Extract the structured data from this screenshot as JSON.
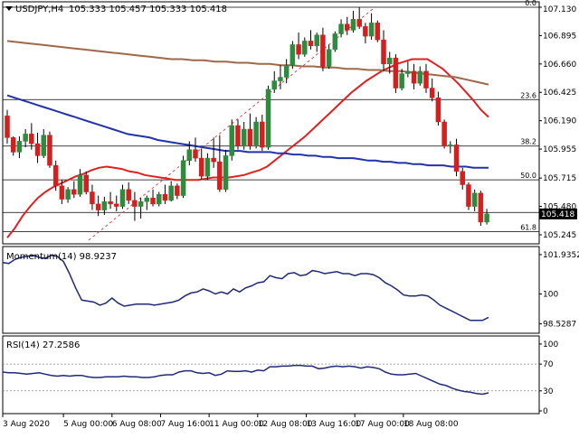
{
  "symbol_header": {
    "icon": "triangle-down-icon",
    "title": "USDJPY,H4",
    "ohlc": "105.333 105.457 105.333 105.418"
  },
  "colors": {
    "bull": "#2e8b3d",
    "bear": "#d21f1f",
    "ma_fast": "#e02020",
    "ma_mid": "#2233aa",
    "ma_slow": "#a0684a",
    "fib": "#000000",
    "trend": "#d21f1f",
    "indicator": "#1f2a7a",
    "price_tag_bg": "#000000",
    "price_tag_fg": "#ffffff"
  },
  "chart_data": [
    {
      "type": "candlestick",
      "name": "USDJPY,H4",
      "ylim": [
        105.2,
        107.13
      ],
      "y_ticks": [
        "107.130",
        "106.895",
        "106.660",
        "106.425",
        "106.190",
        "105.955",
        "105.715",
        "105.480",
        "105.245"
      ],
      "current_price": "105.418",
      "fib_levels": [
        {
          "label": "0.0",
          "value": 107.13
        },
        {
          "label": "23.6",
          "value": 106.365
        },
        {
          "label": "38.2",
          "value": 105.98
        },
        {
          "label": "50.0",
          "value": 105.7
        },
        {
          "label": "61.8",
          "value": 105.27
        }
      ],
      "extra_hline": 105.43,
      "trendline": {
        "from": [
          0,
          105.2
        ],
        "to": [
          71,
          107.13
        ]
      },
      "candles": [
        [
          106.23,
          106.28,
          106.0,
          106.05
        ],
        [
          106.05,
          106.06,
          105.9,
          105.93
        ],
        [
          105.93,
          106.06,
          105.88,
          106.02
        ],
        [
          106.02,
          106.12,
          105.97,
          106.08
        ],
        [
          106.08,
          106.17,
          105.95,
          106.0
        ],
        [
          106.0,
          106.09,
          105.84,
          105.9
        ],
        [
          105.9,
          106.12,
          105.88,
          106.07
        ],
        [
          106.07,
          106.1,
          105.8,
          105.82
        ],
        [
          105.82,
          105.86,
          105.61,
          105.65
        ],
        [
          105.65,
          105.7,
          105.5,
          105.54
        ],
        [
          105.54,
          105.64,
          105.51,
          105.62
        ],
        [
          105.62,
          105.69,
          105.55,
          105.58
        ],
        [
          105.58,
          105.79,
          105.56,
          105.74
        ],
        [
          105.74,
          105.77,
          105.58,
          105.6
        ],
        [
          105.6,
          105.66,
          105.45,
          105.5
        ],
        [
          105.5,
          105.57,
          105.4,
          105.45
        ],
        [
          105.45,
          105.56,
          105.41,
          105.52
        ],
        [
          105.52,
          105.6,
          105.46,
          105.5
        ],
        [
          105.5,
          105.57,
          105.44,
          105.48
        ],
        [
          105.48,
          105.66,
          105.46,
          105.62
        ],
        [
          105.62,
          105.68,
          105.5,
          105.53
        ],
        [
          105.53,
          105.6,
          105.36,
          105.48
        ],
        [
          105.48,
          105.55,
          105.38,
          105.52
        ],
        [
          105.52,
          105.57,
          105.45,
          105.55
        ],
        [
          105.55,
          105.62,
          105.48,
          105.5
        ],
        [
          105.5,
          105.6,
          105.48,
          105.58
        ],
        [
          105.58,
          105.66,
          105.5,
          105.53
        ],
        [
          105.53,
          105.69,
          105.52,
          105.65
        ],
        [
          105.65,
          105.67,
          105.54,
          105.57
        ],
        [
          105.57,
          105.9,
          105.55,
          105.86
        ],
        [
          105.86,
          106.02,
          105.82,
          105.95
        ],
        [
          105.95,
          106.05,
          105.85,
          105.88
        ],
        [
          105.88,
          105.96,
          105.7,
          105.73
        ],
        [
          105.73,
          105.92,
          105.7,
          105.88
        ],
        [
          105.88,
          106.05,
          105.8,
          105.85
        ],
        [
          105.85,
          106.07,
          105.6,
          105.62
        ],
        [
          105.62,
          105.95,
          105.6,
          105.9
        ],
        [
          105.9,
          106.2,
          105.86,
          106.15
        ],
        [
          106.15,
          106.2,
          105.95,
          105.98
        ],
        [
          105.98,
          106.18,
          105.95,
          106.12
        ],
        [
          106.12,
          106.25,
          105.95,
          105.98
        ],
        [
          105.98,
          106.22,
          105.96,
          106.18
        ],
        [
          106.18,
          106.24,
          105.94,
          105.97
        ],
        [
          105.97,
          106.48,
          105.95,
          106.45
        ],
        [
          106.45,
          106.6,
          106.42,
          106.52
        ],
        [
          106.52,
          106.65,
          106.45,
          106.55
        ],
        [
          106.55,
          106.7,
          106.5,
          106.65
        ],
        [
          106.65,
          106.85,
          106.62,
          106.82
        ],
        [
          106.82,
          106.92,
          106.7,
          106.74
        ],
        [
          106.74,
          106.88,
          106.72,
          106.85
        ],
        [
          106.85,
          106.94,
          106.78,
          106.81
        ],
        [
          106.81,
          106.92,
          106.76,
          106.9
        ],
        [
          106.9,
          106.96,
          106.6,
          106.64
        ],
        [
          106.64,
          106.82,
          106.62,
          106.78
        ],
        [
          106.78,
          106.93,
          106.76,
          106.91
        ],
        [
          106.91,
          107.03,
          106.88,
          106.99
        ],
        [
          106.99,
          107.05,
          106.9,
          106.94
        ],
        [
          106.94,
          107.1,
          106.92,
          107.03
        ],
        [
          107.03,
          107.13,
          106.95,
          106.97
        ],
        [
          106.97,
          107.0,
          106.83,
          106.89
        ],
        [
          106.89,
          107.08,
          106.86,
          107.0
        ],
        [
          107.0,
          107.02,
          106.84,
          106.86
        ],
        [
          106.86,
          106.94,
          106.6,
          106.66
        ],
        [
          106.66,
          106.76,
          106.58,
          106.71
        ],
        [
          106.71,
          106.74,
          106.42,
          106.46
        ],
        [
          106.46,
          106.62,
          106.44,
          106.58
        ],
        [
          106.58,
          106.68,
          106.55,
          106.6
        ],
        [
          106.6,
          106.66,
          106.45,
          106.5
        ],
        [
          106.5,
          106.64,
          106.48,
          106.6
        ],
        [
          106.6,
          106.66,
          106.42,
          106.46
        ],
        [
          106.46,
          106.54,
          106.35,
          106.38
        ],
        [
          106.38,
          106.43,
          106.15,
          106.18
        ],
        [
          106.18,
          106.2,
          105.96,
          105.98
        ],
        [
          105.98,
          106.02,
          105.92,
          105.99
        ],
        [
          105.99,
          106.04,
          105.73,
          105.77
        ],
        [
          105.77,
          105.8,
          105.62,
          105.66
        ],
        [
          105.66,
          105.68,
          105.45,
          105.48
        ],
        [
          105.48,
          105.62,
          105.44,
          105.59
        ],
        [
          105.59,
          105.61,
          105.32,
          105.35
        ],
        [
          105.35,
          105.46,
          105.33,
          105.418
        ]
      ],
      "moving_averages": [
        {
          "id": "ma_fast",
          "start": 0,
          "values": [
            105.22,
            105.3,
            105.4,
            105.48,
            105.55,
            105.6,
            105.64,
            105.67,
            105.7,
            105.73,
            105.75,
            105.78,
            105.8,
            105.81,
            105.8,
            105.79,
            105.77,
            105.76,
            105.74,
            105.73,
            105.72,
            105.71,
            105.7,
            105.7,
            105.7,
            105.7,
            105.71,
            105.72,
            105.72,
            105.72,
            105.73,
            105.74,
            105.76,
            105.78,
            105.81,
            105.86,
            105.91,
            105.96,
            106.01,
            106.06,
            106.12,
            106.18,
            106.24,
            106.3,
            106.36,
            106.42,
            106.47,
            106.52,
            106.56,
            106.6,
            106.63,
            106.66,
            106.68,
            106.7,
            106.7,
            106.7,
            106.66,
            106.62,
            106.56,
            106.5,
            106.43,
            106.36,
            106.28,
            106.22
          ]
        },
        {
          "id": "ma_mid",
          "start": 0,
          "values": [
            106.4,
            106.38,
            106.36,
            106.34,
            106.32,
            106.3,
            106.28,
            106.26,
            106.24,
            106.22,
            106.2,
            106.18,
            106.16,
            106.14,
            106.12,
            106.1,
            106.08,
            106.07,
            106.06,
            106.05,
            106.03,
            106.02,
            106.01,
            106.0,
            105.99,
            105.98,
            105.97,
            105.96,
            105.95,
            105.94,
            105.94,
            105.94,
            105.93,
            105.93,
            105.93,
            105.93,
            105.92,
            105.92,
            105.91,
            105.91,
            105.9,
            105.9,
            105.89,
            105.89,
            105.88,
            105.88,
            105.88,
            105.87,
            105.86,
            105.86,
            105.85,
            105.85,
            105.84,
            105.84,
            105.83,
            105.83,
            105.82,
            105.82,
            105.82,
            105.81,
            105.81,
            105.81,
            105.8,
            105.8,
            105.8
          ]
        },
        {
          "id": "ma_slow",
          "start": 0,
          "values": [
            106.85,
            106.84,
            106.83,
            106.82,
            106.81,
            106.8,
            106.79,
            106.78,
            106.77,
            106.76,
            106.75,
            106.74,
            106.73,
            106.72,
            106.71,
            106.7,
            106.7,
            106.69,
            106.69,
            106.68,
            106.68,
            106.67,
            106.67,
            106.66,
            106.66,
            106.65,
            106.65,
            106.64,
            106.64,
            106.63,
            106.63,
            106.62,
            106.62,
            106.61,
            106.61,
            106.6,
            106.6,
            106.59,
            106.58,
            106.57,
            106.56,
            106.55,
            106.53,
            106.51,
            106.49
          ]
        }
      ]
    },
    {
      "type": "line",
      "title": "Momentum(14) 98.9237",
      "ylim": [
        98.2,
        102.2
      ],
      "y_ticks": [
        "101.9352",
        "100",
        "98.5287"
      ],
      "values": [
        101.55,
        101.5,
        101.7,
        101.8,
        101.85,
        101.9,
        101.8,
        101.75,
        101.9,
        101.85,
        101.6,
        101.0,
        100.3,
        99.7,
        99.65,
        99.6,
        99.45,
        99.55,
        99.8,
        99.55,
        99.4,
        99.45,
        99.5,
        99.5,
        99.5,
        99.45,
        99.5,
        99.55,
        99.6,
        99.7,
        99.9,
        100.05,
        100.1,
        100.25,
        100.15,
        100.0,
        100.1,
        100.0,
        100.25,
        100.1,
        100.3,
        100.4,
        100.55,
        100.6,
        100.9,
        100.8,
        100.75,
        101.0,
        101.05,
        100.9,
        100.95,
        101.15,
        101.1,
        101.0,
        101.05,
        101.1,
        101.0,
        101.0,
        100.9,
        101.0,
        101.0,
        100.95,
        100.8,
        100.55,
        100.4,
        100.2,
        99.95,
        99.9,
        99.9,
        99.95,
        99.9,
        99.7,
        99.45,
        99.3,
        99.15,
        99.0,
        98.85,
        98.7,
        98.7,
        98.7,
        98.85
      ]
    },
    {
      "type": "line",
      "title": "RSI(14) 27.2586",
      "ylim": [
        0,
        108
      ],
      "y_ticks": [
        "100",
        "70",
        "30",
        "0"
      ],
      "levels": [
        70,
        30
      ],
      "values": [
        58,
        57,
        57,
        56,
        55,
        56,
        57,
        55,
        53,
        52,
        53,
        52,
        53,
        53,
        51,
        50,
        50,
        51,
        51,
        51,
        52,
        51,
        51,
        50,
        50,
        51,
        53,
        54,
        54,
        58,
        60,
        60,
        57,
        56,
        57,
        53,
        55,
        60,
        59,
        59,
        60,
        58,
        61,
        60,
        66,
        66,
        67,
        67,
        68,
        68,
        67,
        67,
        63,
        64,
        66,
        67,
        66,
        67,
        66,
        64,
        66,
        65,
        63,
        58,
        55,
        54,
        54,
        55,
        56,
        52,
        48,
        44,
        40,
        38,
        34,
        31,
        29,
        28,
        26,
        25,
        27
      ]
    }
  ],
  "x_axis": {
    "labels": [
      "3 Aug 2020",
      "5 Aug 00:00",
      "6 Aug 08:00",
      "7 Aug 16:00",
      "11 Aug 00:00",
      "12 Aug 08:00",
      "13 Aug 16:00",
      "17 Aug 00:00",
      "18 Aug 08:00"
    ],
    "label_bars": [
      0,
      10,
      18,
      26,
      34,
      42,
      50,
      58,
      66
    ]
  }
}
